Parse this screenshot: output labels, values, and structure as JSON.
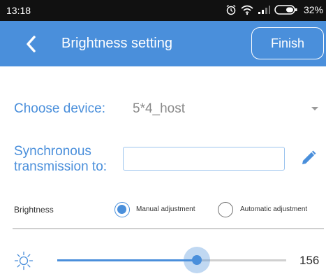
{
  "status_bar": {
    "time": "13:18",
    "battery_percent": "32%",
    "icons": [
      "alarm-icon",
      "wifi-icon",
      "signal-icon",
      "battery-icon"
    ]
  },
  "header": {
    "title": "Brightness setting",
    "finish_label": "Finish",
    "back_icon": "chevron-left-icon"
  },
  "device": {
    "label": "Choose device:",
    "value": "5*4_host"
  },
  "sync": {
    "label_line1": "Synchronous",
    "label_line2": "transmission to:",
    "value": "",
    "edit_icon": "pencil-icon"
  },
  "brightness": {
    "label": "Brightness",
    "mode_options": [
      "Manual adjustment",
      "Automatic adjustment"
    ],
    "selected_mode": "Manual adjustment",
    "value": "156",
    "slider_fraction": 0.61,
    "icon": "sun-icon"
  },
  "colors": {
    "accent": "#4a8fdb",
    "status_bar": "#111111",
    "header_bg": "#4a8fdb",
    "label_text": "#4a8fdb",
    "muted_text": "#8a8a8a"
  }
}
